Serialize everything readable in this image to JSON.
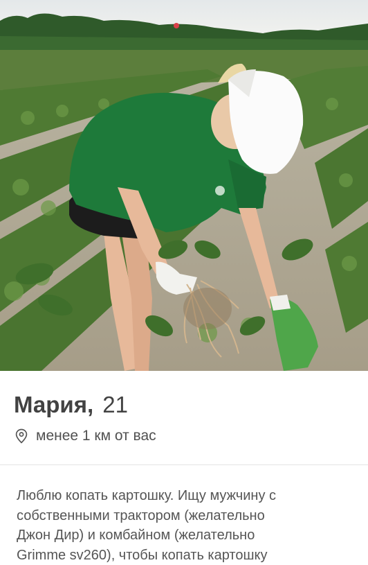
{
  "profile": {
    "name": "Мария,",
    "age": "21",
    "distance": "менее 1 км от вас",
    "bio": "Люблю копать картошку. Ищу мужчину с\nсобственными трактором (желательно\nДжон Дир) и комбайном (желательно\nGrimme sv260), чтобы копать картошку",
    "photo_alt": "photo-potato-field"
  },
  "icons": {
    "location": "location-pin-icon"
  },
  "colors": {
    "text_primary": "#424242",
    "text_secondary": "#505050",
    "bio_text": "#555555",
    "shirt": "#1e7a3a",
    "glove": "#4fa64a"
  }
}
